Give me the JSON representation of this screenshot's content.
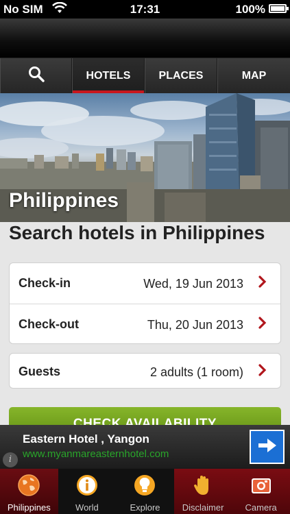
{
  "status_bar": {
    "carrier": "No SIM",
    "time": "17:31",
    "battery_percent": "100%",
    "icons": [
      "wifi-icon",
      "battery-icon"
    ]
  },
  "top_tabs": {
    "search_icon": "search-icon",
    "hotels": "HOTELS",
    "places": "PLACES",
    "map": "MAP",
    "active": "HOTELS",
    "accent_color": "#c8161d"
  },
  "hero": {
    "title": "Philippines"
  },
  "search": {
    "heading": "Search hotels in Philippines",
    "check_in_label": "Check-in",
    "check_in_value": "Wed, 19 Jun 2013",
    "check_out_label": "Check-out",
    "check_out_value": "Thu, 20 Jun 2013",
    "guests_label": "Guests",
    "guests_value": "2 adults (1 room)",
    "button_label": "CHECK AVAILABILITY",
    "button_color": "#6e9e1c",
    "chevron_color": "#b1161c"
  },
  "ad": {
    "title": "Eastern Hotel , Yangon",
    "url": "www.myanmareasternhotel.com",
    "info_label": "i",
    "url_color": "#29a52a",
    "arrow_color": "#1b6fd4"
  },
  "bottom_nav": {
    "items": [
      {
        "label": "Philippines",
        "icon": "globe-icon"
      },
      {
        "label": "World",
        "icon": "info-icon"
      },
      {
        "label": "Explore",
        "icon": "lightbulb-icon"
      },
      {
        "label": "Disclaimer",
        "icon": "hand-icon"
      },
      {
        "label": "Camera",
        "icon": "camera-icon"
      }
    ],
    "active": "Philippines"
  }
}
